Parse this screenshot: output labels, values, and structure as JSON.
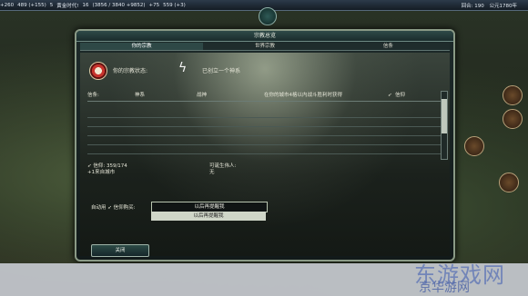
{
  "topbar": {
    "science": "+260",
    "gold": "489 (+155)",
    "happiness": "5",
    "golden_age": "黄金时代!",
    "faith": "16",
    "culture": "(3856 / 3840 +9852)",
    "tourism": "+75",
    "influence": "559 (+3)",
    "turn": "回合: 190",
    "year": "公元1780年"
  },
  "dialog": {
    "title": "宗教总览",
    "tabs": [
      "你的宗教",
      "世界宗教",
      "信条"
    ],
    "status_label": "你的宗教状态:",
    "status_value": "已创立一个神系",
    "table": {
      "col_beliefs": "信条:",
      "col_pantheon": "神系",
      "col_name": "战神",
      "col_desc": "在你的城市4格以内战斗胜利时获得",
      "col_desc_suffix": "信仰"
    },
    "faith_line1": "信仰: 359/174",
    "faith_line2": "+1来自城市",
    "prophet_line1": "可诞生伟人:",
    "prophet_line2": "无",
    "auto_purchase_label": "自动用",
    "auto_purchase_label2": "信仰购买:",
    "auto_purchase_value": "以后再提醒我",
    "auto_purchase_option": "以后再提醒我",
    "close_label": "关闭"
  },
  "watermark": {
    "line1": "东游戏网",
    "line2": "京华游网"
  },
  "icons": {
    "religion": "religion-emblem-icon",
    "status": "lightning-icon",
    "faith": "faith-icon"
  }
}
